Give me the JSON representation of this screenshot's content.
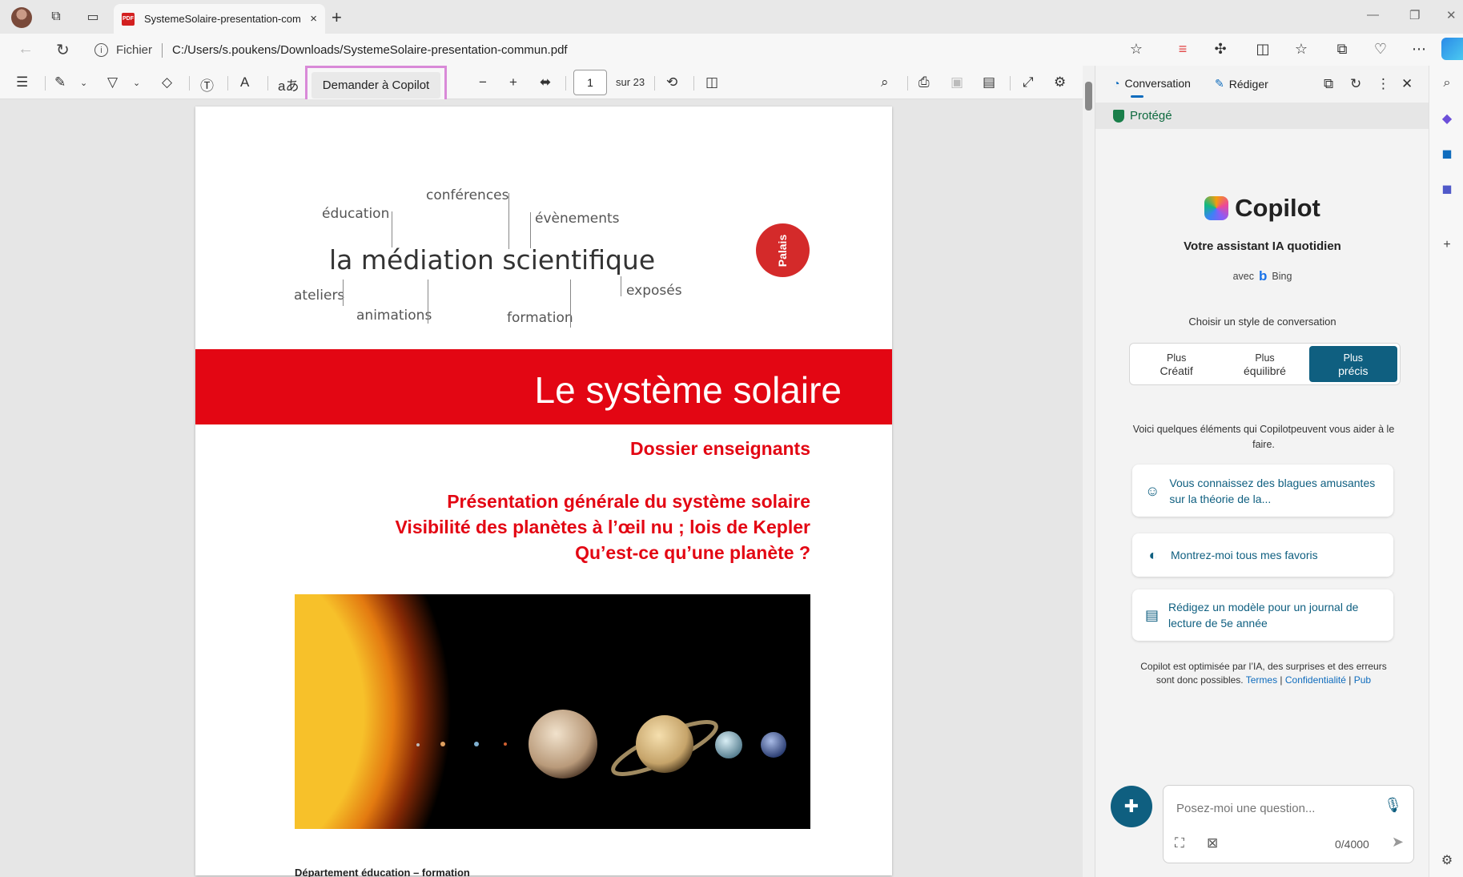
{
  "browser": {
    "tab_title": "SystemeSolaire-presentation-com",
    "tab_close": "×",
    "new_tab": "+",
    "address_label": "Fichier",
    "url": "C:/Users/s.poukens/Downloads/SystemeSolaire-presentation-commun.pdf",
    "pdf_icon_text": "PDF"
  },
  "pdf_toolbar": {
    "ask_copilot": "Demander à Copilot",
    "page_current": "1",
    "page_total": "sur 23"
  },
  "document": {
    "words": {
      "conferences": "conférences",
      "education": "éducation",
      "evenements": "évènements",
      "main": "la médiation scientifique",
      "ateliers": "ateliers",
      "exposes": "exposés",
      "animations": "animations",
      "formation": "formation"
    },
    "badge": "Palais",
    "title": "Le système solaire",
    "subtitle_1": "Dossier enseignants",
    "subtitle_2": "Présentation générale du système solaire",
    "subtitle_3": "Visibilité des planètes à l’œil nu ; lois de Kepler",
    "subtitle_4": "Qu’est-ce qu’une planète ?",
    "footer": "Département éducation – formation"
  },
  "copilot": {
    "tab_conversation": "Conversation",
    "tab_compose": "Rédiger",
    "protected": "Protégé",
    "title": "Copilot",
    "tagline": "Votre assistant IA quotidien",
    "with": "avec",
    "bing": "Bing",
    "choose_style": "Choisir un style de conversation",
    "styles": [
      {
        "line1": "Plus",
        "line2": "Créatif"
      },
      {
        "line1": "Plus",
        "line2": "équilibré"
      },
      {
        "line1": "Plus",
        "line2": "précis"
      }
    ],
    "intro": "Voici quelques éléments qui Copilotpeuvent vous aider à le faire.",
    "suggestions": [
      "Vous connaissez des blagues amusantes sur la théorie de la...",
      "Montrez-moi tous mes favoris",
      "Rédigez un modèle pour un journal de lecture de 5e année"
    ],
    "disclaimer": "Copilot est optimisée par l’IA, des surprises et des erreurs sont donc possibles.",
    "link_terms": "Termes",
    "link_privacy": "Confidentialité",
    "link_ads": "Pub",
    "input_placeholder": "Posez-moi une question...",
    "char_count": "0/4000"
  },
  "colors": {
    "accent": "#0f5f80",
    "doc_red": "#e30613",
    "highlight_border": "#d98ad8"
  }
}
